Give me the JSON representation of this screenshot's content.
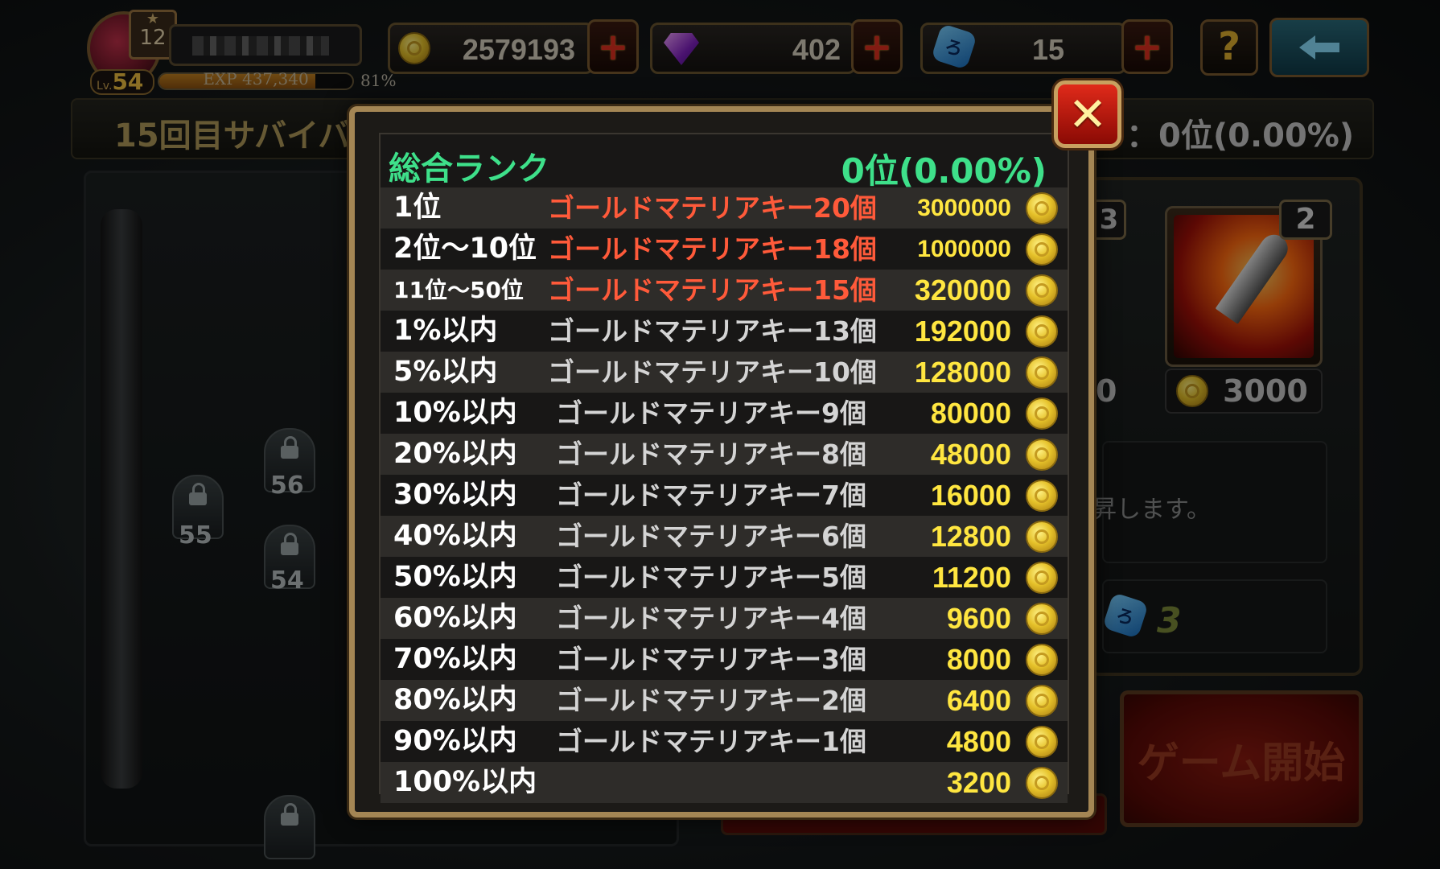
{
  "hud": {
    "star_level": "12",
    "level_prefix": "Lv.",
    "level": "54",
    "exp_text": "EXP 437,340",
    "exp_percent_text": "81%",
    "exp_fraction": 0.81,
    "gold": "2579193",
    "gems": "402",
    "dice": "15",
    "help_label": "?"
  },
  "background": {
    "title": "15回目サバイバ",
    "rank_summary": "ク：0位(0.00%)",
    "map_nodes": [
      "56",
      "55",
      "54"
    ],
    "partial_badge": "3",
    "skill_badge": "2",
    "skill_price": "3000",
    "partial_price": "0",
    "description": "昇します。",
    "dice_cost": "3",
    "start_button": "ゲーム開始"
  },
  "popup": {
    "title": "総合ランク",
    "my_rank": "0位(0.00%)",
    "close_label": "✕",
    "rows": [
      {
        "rank": "1位",
        "reward": "ゴールドマテリアキー20個",
        "gold": "3000000",
        "hot": true
      },
      {
        "rank": "2位～10位",
        "reward": "ゴールドマテリアキー18個",
        "gold": "1000000",
        "hot": true
      },
      {
        "rank": "11位～50位",
        "reward": "ゴールドマテリアキー15個",
        "gold": "320000",
        "hot": true
      },
      {
        "rank": "1%以内",
        "reward": "ゴールドマテリアキー13個",
        "gold": "192000",
        "hot": false
      },
      {
        "rank": "5%以内",
        "reward": "ゴールドマテリアキー10個",
        "gold": "128000",
        "hot": false
      },
      {
        "rank": "10%以内",
        "reward": "ゴールドマテリアキー9個",
        "gold": "80000",
        "hot": false
      },
      {
        "rank": "20%以内",
        "reward": "ゴールドマテリアキー8個",
        "gold": "48000",
        "hot": false
      },
      {
        "rank": "30%以内",
        "reward": "ゴールドマテリアキー7個",
        "gold": "16000",
        "hot": false
      },
      {
        "rank": "40%以内",
        "reward": "ゴールドマテリアキー6個",
        "gold": "12800",
        "hot": false
      },
      {
        "rank": "50%以内",
        "reward": "ゴールドマテリアキー5個",
        "gold": "11200",
        "hot": false
      },
      {
        "rank": "60%以内",
        "reward": "ゴールドマテリアキー4個",
        "gold": "9600",
        "hot": false
      },
      {
        "rank": "70%以内",
        "reward": "ゴールドマテリアキー3個",
        "gold": "8000",
        "hot": false
      },
      {
        "rank": "80%以内",
        "reward": "ゴールドマテリアキー2個",
        "gold": "6400",
        "hot": false
      },
      {
        "rank": "90%以内",
        "reward": "ゴールドマテリアキー1個",
        "gold": "4800",
        "hot": false
      },
      {
        "rank": "100%以内",
        "reward": "",
        "gold": "3200",
        "hot": false
      }
    ]
  },
  "colors": {
    "accent_green": "#3ee08a",
    "hot_reward": "#ff5a3a",
    "gold_text": "#ffe640",
    "frame_gold": "#a48654"
  }
}
